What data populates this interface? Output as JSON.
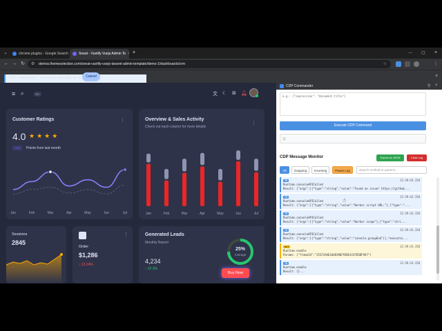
{
  "browser": {
    "tabs": [
      {
        "label": "chrome plugins - Google Search",
        "color": "#4285f4"
      },
      {
        "label": "Sneat - Vuetify Vuejs Admin Te",
        "color": "#7367f0"
      }
    ],
    "new_tab": "+",
    "url": "demos.themeselection.com/sneat-vuetify-vuejs-laravel-admin-template/demo-1/dashboards/crm",
    "infobar": {
      "message": "\"CDP Commander\" started debugging this browser",
      "cancel_label": "Cancel"
    }
  },
  "app": {
    "search_kbd": "⌘K",
    "customer_ratings": {
      "title": "Customer Ratings",
      "rating": "4.0",
      "stars": 4,
      "delta": "-1.0",
      "delta_label": "Points from last month",
      "months": [
        "Jan",
        "Feb",
        "Mar",
        "Apr",
        "May",
        "Jun",
        "Jul"
      ]
    },
    "overview": {
      "title": "Overview & Sales Activity",
      "subtitle": "Check out each column for more details",
      "months": [
        "Jan",
        "Feb",
        "Mar",
        "Apr",
        "May",
        "Jun",
        "Jul"
      ]
    },
    "sessions": {
      "title": "Sessions",
      "value": "2845"
    },
    "order": {
      "title": "Order",
      "value": "$1,286",
      "delta": "↓ 13.24%"
    },
    "leads": {
      "title": "Generated Leads",
      "subtitle": "Monthly Report",
      "value": "4,234",
      "delta": "↑ 22.3%",
      "ring_value": "25%",
      "ring_label": "Average",
      "buy_label": "Buy Now"
    },
    "colors": {
      "bg": "#25293c",
      "card": "#2f3349",
      "accent": "#7367f0",
      "bar_red": "#ea2626",
      "success": "#28c76f"
    }
  },
  "chart_data": [
    {
      "type": "line",
      "title": "Customer Ratings",
      "categories": [
        "Jan",
        "Feb",
        "Mar",
        "Apr",
        "May",
        "Jun",
        "Jul"
      ],
      "series": [
        {
          "values": [
            30,
            48,
            70,
            38,
            52,
            35,
            75
          ]
        },
        {
          "values": [
            20,
            30,
            35,
            22,
            30,
            20,
            40
          ]
        }
      ],
      "ylim": [
        0,
        100
      ]
    },
    {
      "type": "bar",
      "title": "Overview & Sales Activity",
      "categories": [
        "Jan",
        "Feb",
        "Mar",
        "Apr",
        "May",
        "Jun",
        "Jul"
      ],
      "series": [
        {
          "values": [
            66,
            40,
            52,
            62,
            38,
            70,
            53
          ]
        },
        {
          "values": [
            82,
            58,
            74,
            83,
            58,
            87,
            74
          ]
        }
      ],
      "ylim": [
        0,
        100
      ]
    }
  ],
  "panel": {
    "title": "CDP Commander",
    "code_placeholder": "e.g.: {\"expression\": \"document.title\"}",
    "execute_label": "Execute CDP Command",
    "result_text": "[]",
    "monitor_title": "CDP Message Monitor",
    "export_label": "Export as JSON",
    "clear_label": "Clear Log",
    "filters": [
      "All",
      "Outgoing",
      "Incoming",
      "Pause Log"
    ],
    "search_placeholder": "Search method or params...",
    "messages": [
      {
        "badge": "IN",
        "time": "12:39:43.150",
        "method": "Runtime.consoleAPICalled",
        "result": "Result: {\"args\":[{\"type\":\"string\",\"value\":\"Found an issue! https://github...",
        "kind": "in"
      },
      {
        "badge": "IN",
        "time": "12:39:43.150",
        "method": "Runtime.consoleAPICalled",
        "result": "Result: {\"args\":[{\"type\":\"string\",\"value\":\"Worker script URL:\"},{\"type\":\"...",
        "kind": "in"
      },
      {
        "badge": "IN",
        "time": "12:39:43.150",
        "method": "Runtime.consoleAPICalled",
        "result": "Result: {\"args\":[{\"type\":\"string\",\"value\":\"Worker scope\"},{\"type\":\"stri...",
        "kind": "in"
      },
      {
        "badge": "IN",
        "time": "12:39:43.150",
        "method": "Runtime.consoleAPICalled",
        "result": "Result: {\"args\":[{\"type\":\"string\",\"value\":\"console.groupEnd\"}],\"executio...",
        "kind": "in"
      },
      {
        "badge": "OUT",
        "time": "12:39:43.150",
        "method": "Runtime.enable",
        "result": "Params: {\"frameId\":\"351F2AAE1048396F93DA1C47B3DF9A7\"}",
        "kind": "warn"
      },
      {
        "badge": "IN",
        "time": "12:39:43.150",
        "method": "Runtime.enable",
        "result": "Result: {}...",
        "kind": "in"
      }
    ]
  }
}
